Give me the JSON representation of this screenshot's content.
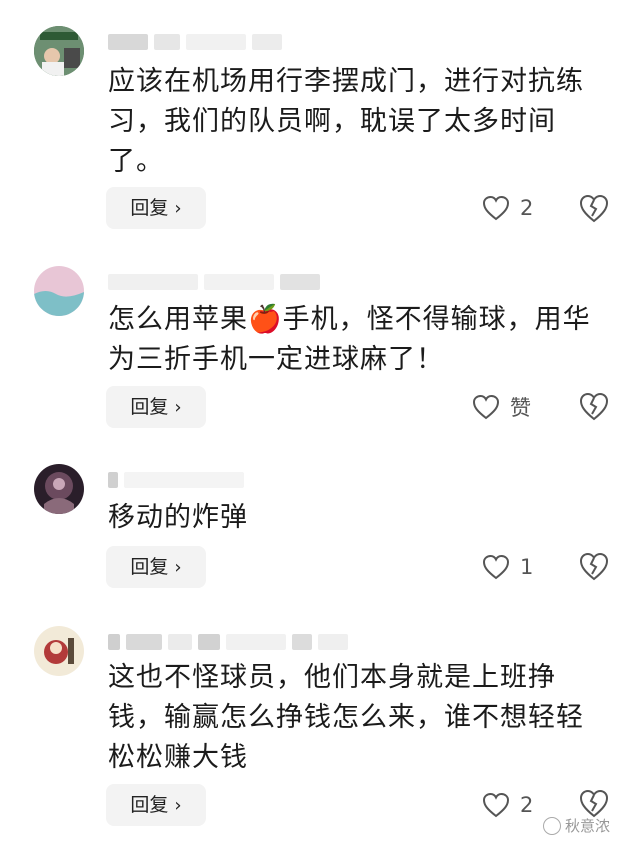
{
  "comments": [
    {
      "text": "应该在机场用行李摆成门，进行对抗练习，我们的队员啊，耽误了太多时间了。",
      "reply_label": "回复",
      "like_count": "2"
    },
    {
      "text": "怎么用苹果🍎手机，怪不得输球，用华为三折手机一定进球麻了！",
      "reply_label": "回复",
      "like_count": "赞"
    },
    {
      "text": "移动的炸弹",
      "reply_label": "回复",
      "like_count": "1"
    },
    {
      "text": "这也不怪球员，他们本身就是上班挣钱，输赢怎么挣钱怎么来，谁不想轻轻松松赚大钱",
      "reply_label": "回复",
      "like_count": "2"
    }
  ],
  "icons": {
    "chevron": "chevron-right-icon",
    "like": "heart-outline-icon",
    "dislike": "broken-heart-icon"
  },
  "watermark": {
    "text": "秋意浓"
  }
}
